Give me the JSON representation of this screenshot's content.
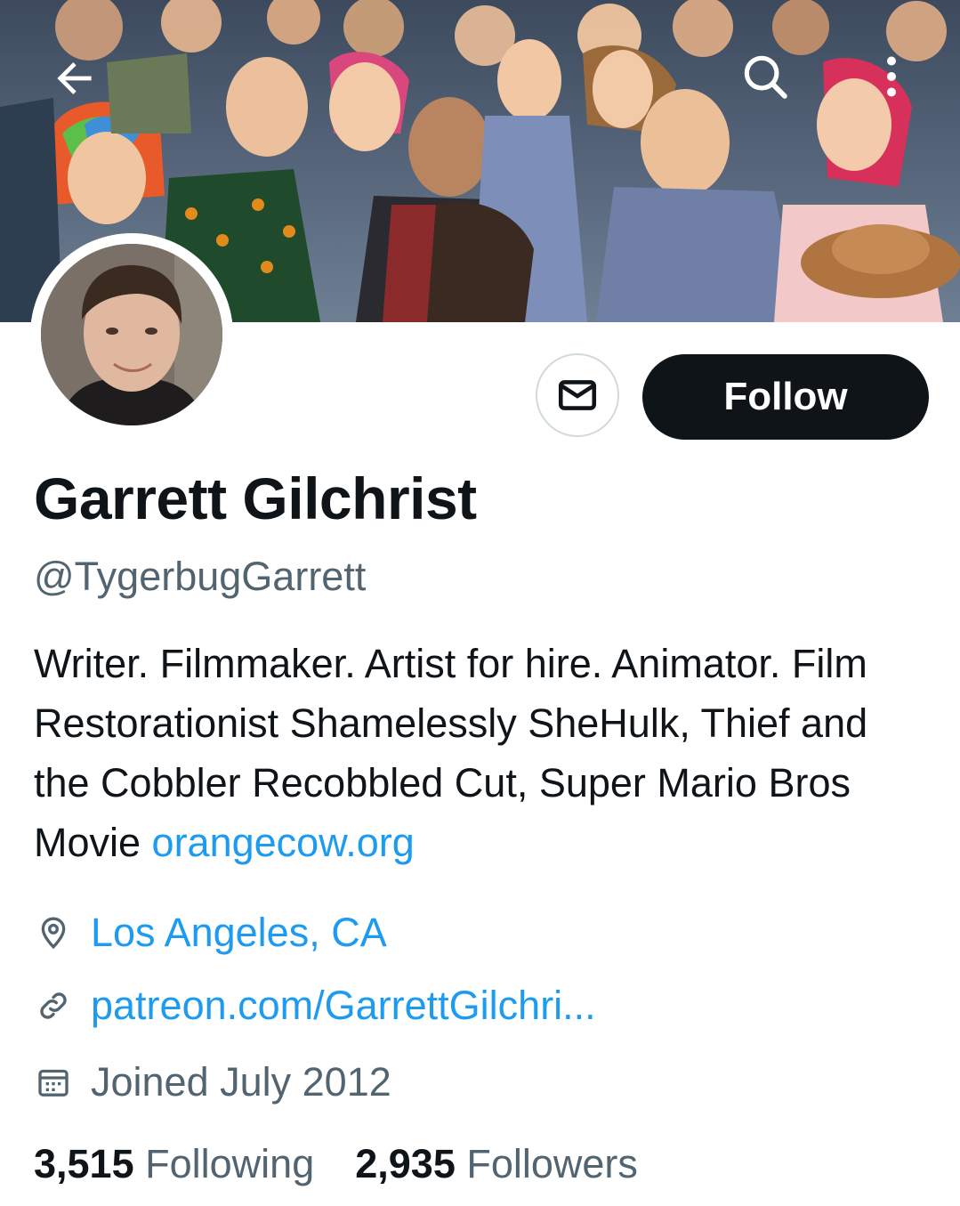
{
  "header": {
    "back_icon": "arrow-left-icon",
    "search_icon": "search-icon",
    "more_icon": "more-vertical-icon"
  },
  "profile": {
    "name": "Garrett Gilchrist",
    "handle": "@TygerbugGarrett",
    "bio_text": "Writer. Filmmaker. Artist for hire. Animator. Film Restorationist Shamelessly SheHulk, Thief and the Cobbler Recobbled Cut, Super Mario Bros Movie ",
    "bio_link": "orangecow.org",
    "location": "Los Angeles, CA",
    "website": "patreon.com/GarrettGilchri...",
    "joined": "Joined July 2012"
  },
  "actions": {
    "message_icon": "envelope-icon",
    "follow_label": "Follow"
  },
  "stats": {
    "following_count": "3,515",
    "following_label": "Following",
    "followers_count": "2,935",
    "followers_label": "Followers"
  },
  "colors": {
    "accent": "#1d9bf0",
    "text_primary": "#0f1419",
    "text_secondary": "#536471",
    "button_dark": "#0f1419"
  }
}
